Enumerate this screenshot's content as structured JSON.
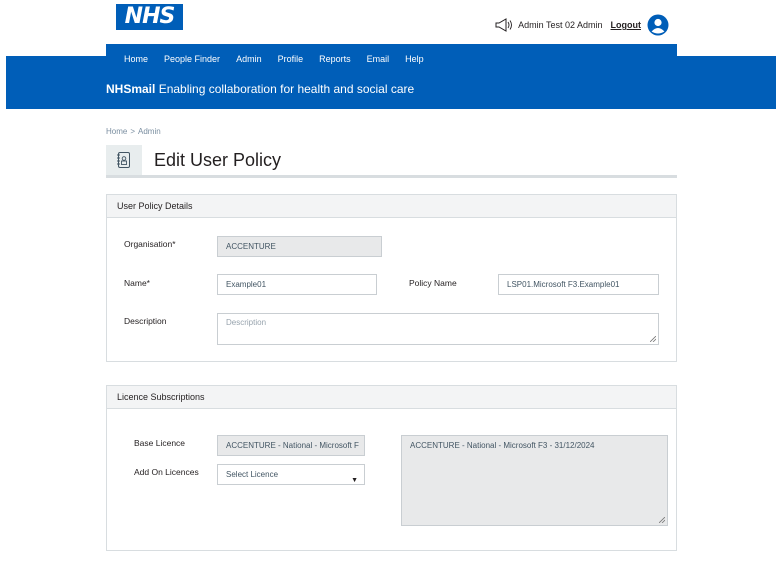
{
  "header": {
    "logo": "NHS",
    "user_name": "Admin  Test 02 Admin",
    "logout_label": "Logout"
  },
  "nav": {
    "items": [
      "Home",
      "People Finder",
      "Admin",
      "Profile",
      "Reports",
      "Email",
      "Help"
    ]
  },
  "tagline": {
    "brand": "NHSmail",
    "text": " Enabling collaboration for health and social care"
  },
  "breadcrumb": {
    "home": "Home",
    "separator": ">",
    "current": "Admin"
  },
  "page": {
    "title": "Edit User Policy",
    "icon": "policy-document-icon"
  },
  "user_policy_details": {
    "title": "User Policy Details",
    "organisation_label": "Organisation*",
    "organisation_value": "ACCENTURE",
    "name_label": "Name*",
    "name_value": "Example01",
    "policy_name_label": "Policy Name",
    "policy_name_value": "LSP01.Microsoft F3.Example01",
    "description_label": "Description",
    "description_placeholder": "Description"
  },
  "licence_subscriptions": {
    "title": "Licence Subscriptions",
    "base_licence_label": "Base Licence",
    "base_licence_value": "ACCENTURE - National - Microsoft F",
    "add_on_label": "Add On Licences",
    "add_on_selected": "Select Licence",
    "summary_text": "ACCENTURE - National - Microsoft F3 - 31/12/2024"
  },
  "colors": {
    "nhs_blue": "#005eb8",
    "panel_header": "#f3f4f5",
    "readonly_field": "#e8e9ea"
  }
}
